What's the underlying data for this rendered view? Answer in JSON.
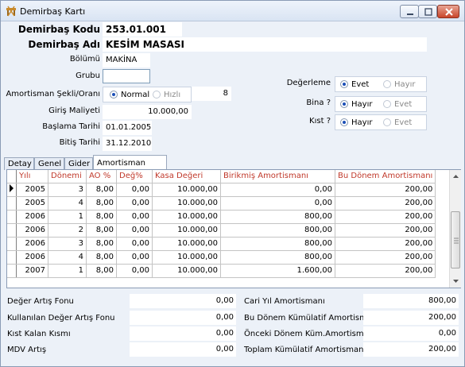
{
  "window": {
    "title": "Demirbaş Kartı"
  },
  "header": {
    "kod_label": "Demirbaş Kodu",
    "kod_value": "253.01.001",
    "ad_label": "Demirbaş Adı",
    "ad_value": "KESİM MASASI",
    "bolum_label": "Bölümü",
    "bolum_value": "MAKİNA",
    "grup_label": "Grubu",
    "grup_value": "",
    "amort_label": "Amortisman Şekli/Oranı",
    "amort_normal": "Normal",
    "amort_hizli": "Hızlı",
    "amort_rate": "8",
    "maliyet_label": "Giriş Maliyeti",
    "maliyet_value": "10.000,00",
    "baslama_label": "Başlama Tarihi",
    "baslama_value": "01.01.2005",
    "bitis_label": "Bitiş Tarihi",
    "bitis_value": "31.12.2010"
  },
  "options": {
    "degerleme_label": "Değerleme",
    "bina_label": "Bina ?",
    "kist_label": "Kıst ?",
    "evet": "Evet",
    "hayir": "Hayır"
  },
  "tabs": [
    "Detay",
    "Genel",
    "Gider",
    "Amortisman"
  ],
  "grid": {
    "columns": [
      "Yılı",
      "Dönemi",
      "AO %",
      "Değ%",
      "Kasa Değeri",
      "Birikmiş Amortismanı",
      "Bu Dönem Amortismanı"
    ],
    "rows": [
      [
        "2005",
        "3",
        "8,00",
        "0,00",
        "10.000,00",
        "0,00",
        "200,00"
      ],
      [
        "2005",
        "4",
        "8,00",
        "0,00",
        "10.000,00",
        "0,00",
        "200,00"
      ],
      [
        "2006",
        "1",
        "8,00",
        "0,00",
        "10.000,00",
        "800,00",
        "200,00"
      ],
      [
        "2006",
        "2",
        "8,00",
        "0,00",
        "10.000,00",
        "800,00",
        "200,00"
      ],
      [
        "2006",
        "3",
        "8,00",
        "0,00",
        "10.000,00",
        "800,00",
        "200,00"
      ],
      [
        "2006",
        "4",
        "8,00",
        "0,00",
        "10.000,00",
        "800,00",
        "200,00"
      ],
      [
        "2007",
        "1",
        "8,00",
        "0,00",
        "10.000,00",
        "1.600,00",
        "200,00"
      ]
    ]
  },
  "footer": {
    "deger_artis_label": "Değer Artış Fonu",
    "deger_artis_value": "0,00",
    "kullanilan_label": "Kullanılan Değer Artış Fonu",
    "kullanilan_value": "0,00",
    "kist_kalan_label": "Kıst Kalan Kısmı",
    "kist_kalan_value": "0,00",
    "mdv_label": "MDV Artış",
    "mdv_value": "0,00",
    "cari_label": "Cari Yıl Amortismanı",
    "cari_value": "800,00",
    "bu_donem_label": "Bu Dönem Kümülatif Amortism.",
    "bu_donem_value": "200,00",
    "onceki_label": "Önceki Dönem Küm.Amortism.",
    "onceki_value": "0,00",
    "toplam_label": "Toplam Kümülatif Amortisman",
    "toplam_value": "200,00"
  }
}
